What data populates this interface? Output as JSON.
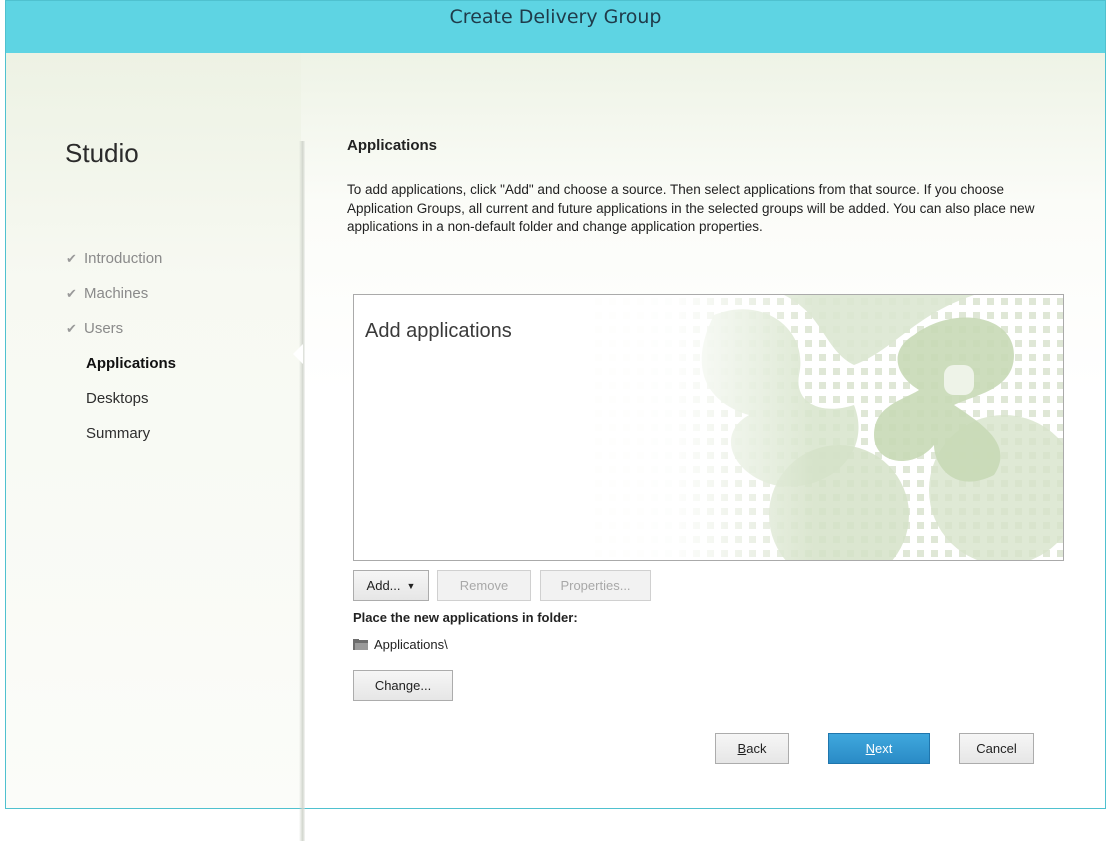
{
  "window": {
    "title": "Create Delivery Group"
  },
  "sidebar": {
    "brand": "Studio",
    "steps": [
      {
        "label": "Introduction",
        "status": "done"
      },
      {
        "label": "Machines",
        "status": "done"
      },
      {
        "label": "Users",
        "status": "done"
      },
      {
        "label": "Applications",
        "status": "current"
      },
      {
        "label": "Desktops",
        "status": "pending"
      },
      {
        "label": "Summary",
        "status": "pending"
      }
    ],
    "check_glyph": "✔"
  },
  "main": {
    "heading": "Applications",
    "description": "To add applications, click \"Add\" and choose a source. Then select applications from that source. If you choose Application Groups, all current and future applications in the selected groups will be added. You can also place new applications in a non-default folder and change application properties.",
    "apps_placeholder": "Add applications",
    "add_label": "Add...",
    "remove_label": "Remove",
    "properties_label": "Properties...",
    "folder_label": "Place the new applications in folder:",
    "folder_path": "Applications\\",
    "change_label": "Change..."
  },
  "footer": {
    "back_label": "Back",
    "back_accel": "B",
    "back_rest": "ack",
    "next_label": "Next",
    "next_accel": "N",
    "next_rest": "ext",
    "cancel_label": "Cancel"
  },
  "colors": {
    "titlebar": "#5ed4e3",
    "primary_button": "#2a8bc6",
    "watermark": "#b9cfa6"
  }
}
